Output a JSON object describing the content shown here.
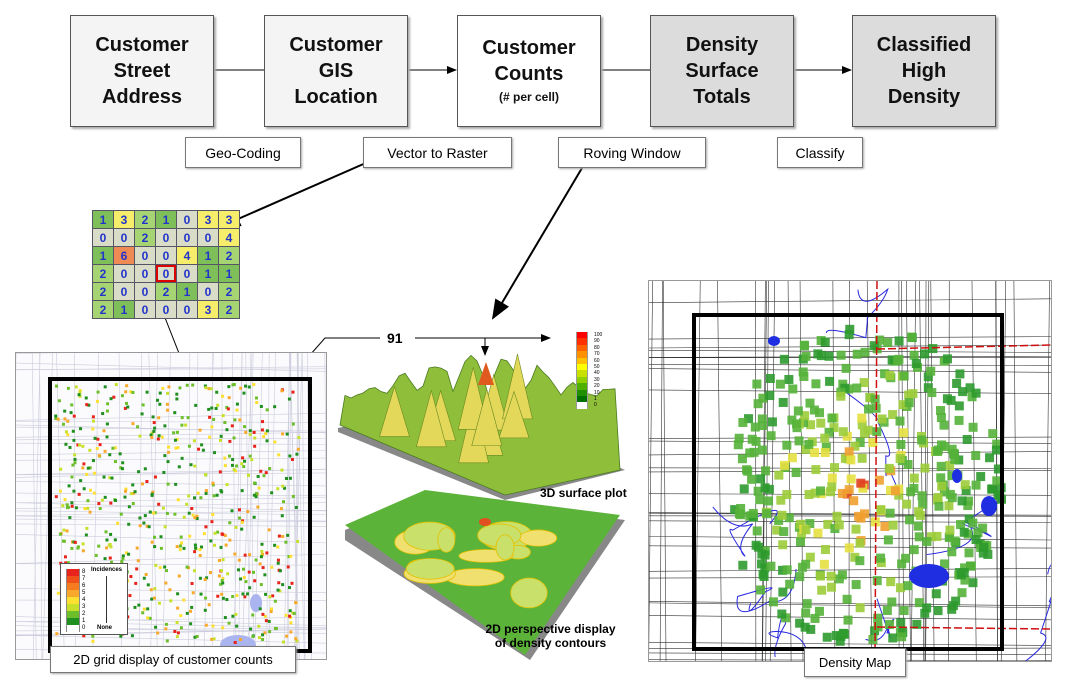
{
  "flow": {
    "boxes": [
      {
        "line1": "Customer",
        "line2": "Street",
        "line3": "Address"
      },
      {
        "line1": "Customer",
        "line2": "GIS",
        "line3": "Location"
      },
      {
        "line1": "Customer",
        "line2": "Counts",
        "line3": "(# per cell)"
      },
      {
        "line1": "Density",
        "line2": "Surface",
        "line3": "Totals"
      },
      {
        "line1": "Classified",
        "line2": "High",
        "line3": "Density"
      }
    ],
    "steps": [
      "Geo-Coding",
      "Vector to Raster",
      "Roving Window",
      "Classify"
    ]
  },
  "grid": {
    "rows": [
      [
        1,
        3,
        2,
        1,
        0,
        3,
        3
      ],
      [
        0,
        0,
        2,
        0,
        0,
        0,
        4
      ],
      [
        1,
        6,
        0,
        0,
        4,
        1,
        2
      ],
      [
        2,
        0,
        0,
        0,
        0,
        1,
        1
      ],
      [
        2,
        0,
        0,
        2,
        1,
        0,
        2
      ],
      [
        2,
        1,
        0,
        0,
        0,
        3,
        2
      ]
    ],
    "selected": [
      3,
      3
    ],
    "colors": {
      "0": "#d9dcc6",
      "1": "#7fbf5a",
      "2": "#a6d473",
      "3": "#f6ee6a",
      "4": "#f6ee6a",
      "6": "#f08a55"
    }
  },
  "left_map": {
    "caption": "2D grid display of customer counts",
    "legend": {
      "values": [
        "8",
        "7",
        "6",
        "5",
        "4",
        "3",
        "2",
        "1",
        "0"
      ],
      "colors": [
        "#e8231b",
        "#f0501a",
        "#f57d1f",
        "#f8a82a",
        "#fde030",
        "#c8e02a",
        "#6cbf2a",
        "#1f8f1f",
        "#ffffff"
      ],
      "top_label": "Incidences",
      "bottom_label": "None"
    }
  },
  "surface": {
    "peak_value": "91",
    "caption_3d": "3D surface plot",
    "caption_2d_line1": "2D perspective display",
    "caption_2d_line2": "of density contours",
    "legend": {
      "values": [
        "100",
        "90",
        "80",
        "70",
        "60",
        "50",
        "40",
        "30",
        "20",
        "10",
        "1",
        "0"
      ],
      "colors": [
        "#ff0000",
        "#ff3000",
        "#ff6000",
        "#ff9000",
        "#ffc000",
        "#ffff00",
        "#c8e000",
        "#90d000",
        "#50b000",
        "#209000",
        "#007000",
        "#ffffff"
      ]
    }
  },
  "right_map": {
    "caption": "Density Map"
  }
}
